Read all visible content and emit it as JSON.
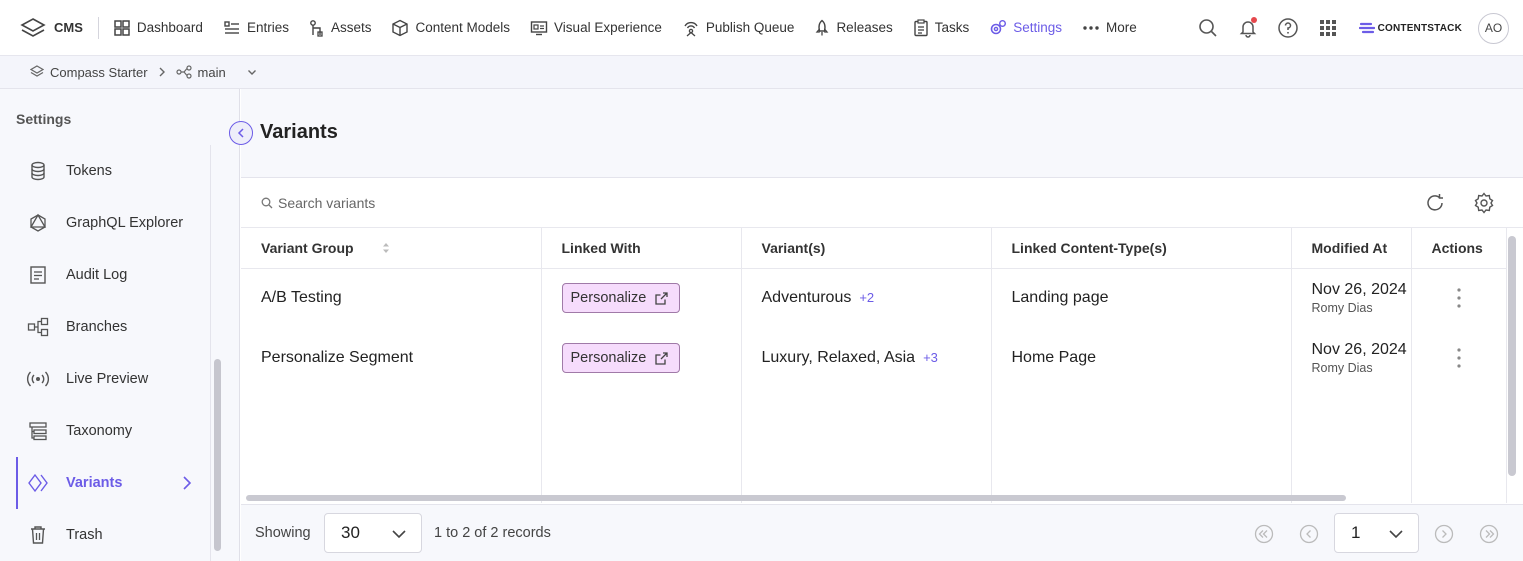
{
  "topnav": {
    "brand": "CMS",
    "items": [
      {
        "label": "Dashboard",
        "icon": "dashboard-icon"
      },
      {
        "label": "Entries",
        "icon": "entries-icon"
      },
      {
        "label": "Assets",
        "icon": "assets-icon"
      },
      {
        "label": "Content Models",
        "icon": "cube-icon"
      },
      {
        "label": "Visual Experience",
        "icon": "visual-experience-icon"
      },
      {
        "label": "Publish Queue",
        "icon": "publish-queue-icon"
      },
      {
        "label": "Releases",
        "icon": "rocket-icon"
      },
      {
        "label": "Tasks",
        "icon": "tasks-icon"
      },
      {
        "label": "Settings",
        "icon": "gear-icon",
        "active": true
      },
      {
        "label": "More",
        "icon": "more-dots-icon"
      }
    ],
    "logo_text": "CONTENTSTACK",
    "avatar": "AO",
    "accent": "#6c5ce7"
  },
  "breadcrumb": {
    "stack": "Compass Starter",
    "branch": "main"
  },
  "sidebar": {
    "title": "Settings",
    "items": [
      {
        "label": "Tokens",
        "icon": "database-icon"
      },
      {
        "label": "GraphQL Explorer",
        "icon": "graphql-icon"
      },
      {
        "label": "Audit Log",
        "icon": "audit-log-icon"
      },
      {
        "label": "Branches",
        "icon": "branches-icon"
      },
      {
        "label": "Live Preview",
        "icon": "live-preview-icon"
      },
      {
        "label": "Taxonomy",
        "icon": "taxonomy-icon"
      },
      {
        "label": "Variants",
        "icon": "variants-icon",
        "active": true
      },
      {
        "label": "Trash",
        "icon": "trash-icon"
      }
    ]
  },
  "main": {
    "title": "Variants",
    "search_placeholder": "Search variants",
    "columns": [
      "Variant Group",
      "Linked With",
      "Variant(s)",
      "Linked Content-Type(s)",
      "Modified At",
      "Actions"
    ],
    "rows": [
      {
        "group": "A/B Testing",
        "linked": "Personalize",
        "variants": "Adventurous",
        "more": "+2",
        "content_type": "Landing page",
        "date": "Nov 26, 2024",
        "user": "Romy Dias"
      },
      {
        "group": "Personalize Segment",
        "linked": "Personalize",
        "variants": "Luxury, Relaxed, Asia",
        "more": "+3",
        "content_type": "Home Page",
        "date": "Nov 26, 2024",
        "user": "Romy Dias"
      }
    ]
  },
  "footer": {
    "showing_label": "Showing",
    "page_size": "30",
    "range": "1 to 2 of 2 records",
    "page": "1"
  }
}
